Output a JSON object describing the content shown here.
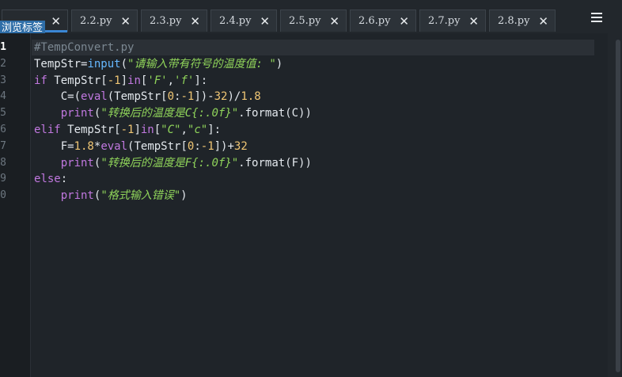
{
  "tabs": [
    {
      "label": "",
      "active": true
    },
    {
      "label": "2.2.py"
    },
    {
      "label": "2.3.py"
    },
    {
      "label": "2.4.py"
    },
    {
      "label": "2.5.py"
    },
    {
      "label": "2.6.py"
    },
    {
      "label": "2.7.py"
    },
    {
      "label": "2.8.py"
    }
  ],
  "tooltip": "浏览标签",
  "colors": {
    "accent": "#3a86d4",
    "background": "#1f2429"
  },
  "editor": {
    "line_numbers": [
      "1",
      "2",
      "3",
      "4",
      "5",
      "6",
      "7",
      "8",
      "9",
      "0"
    ],
    "current_line": 1,
    "lines": [
      [
        {
          "t": "#TempConvert.py",
          "c": "c"
        }
      ],
      [
        {
          "t": "TempStr=",
          "c": "op"
        },
        {
          "t": "input",
          "c": "fn"
        },
        {
          "t": "(",
          "c": "op"
        },
        {
          "t": "\"请输入带有符号的温度值: \"",
          "c": "str"
        },
        {
          "t": ")",
          "c": "op"
        }
      ],
      [
        {
          "t": "if",
          "c": "kw"
        },
        {
          "t": " TempStr[",
          "c": "op"
        },
        {
          "t": "-1",
          "c": "num"
        },
        {
          "t": "]",
          "c": "op"
        },
        {
          "t": "in",
          "c": "kw"
        },
        {
          "t": "[",
          "c": "op"
        },
        {
          "t": "'F'",
          "c": "str"
        },
        {
          "t": ",",
          "c": "op"
        },
        {
          "t": "'f'",
          "c": "str"
        },
        {
          "t": "]:",
          "c": "op"
        }
      ],
      [
        {
          "t": "    C=(",
          "c": "op"
        },
        {
          "t": "eval",
          "c": "kw"
        },
        {
          "t": "(TempStr[",
          "c": "op"
        },
        {
          "t": "0",
          "c": "num"
        },
        {
          "t": ":",
          "c": "op"
        },
        {
          "t": "-1",
          "c": "num"
        },
        {
          "t": "])-",
          "c": "op"
        },
        {
          "t": "32",
          "c": "num"
        },
        {
          "t": ")/",
          "c": "op"
        },
        {
          "t": "1.8",
          "c": "num"
        }
      ],
      [
        {
          "t": "    ",
          "c": "op"
        },
        {
          "t": "print",
          "c": "kw"
        },
        {
          "t": "(",
          "c": "op"
        },
        {
          "t": "\"转换后的温度是C{:.0f}\"",
          "c": "str"
        },
        {
          "t": ".format(C))",
          "c": "op"
        }
      ],
      [
        {
          "t": "elif",
          "c": "kw"
        },
        {
          "t": " TempStr[",
          "c": "op"
        },
        {
          "t": "-1",
          "c": "num"
        },
        {
          "t": "]",
          "c": "op"
        },
        {
          "t": "in",
          "c": "kw"
        },
        {
          "t": "[",
          "c": "op"
        },
        {
          "t": "\"C\"",
          "c": "str"
        },
        {
          "t": ",",
          "c": "op"
        },
        {
          "t": "\"c\"",
          "c": "str"
        },
        {
          "t": "]:",
          "c": "op"
        }
      ],
      [
        {
          "t": "    F=",
          "c": "op"
        },
        {
          "t": "1.8",
          "c": "num"
        },
        {
          "t": "*",
          "c": "op"
        },
        {
          "t": "eval",
          "c": "kw"
        },
        {
          "t": "(TempStr[",
          "c": "op"
        },
        {
          "t": "0",
          "c": "num"
        },
        {
          "t": ":",
          "c": "op"
        },
        {
          "t": "-1",
          "c": "num"
        },
        {
          "t": "])+",
          "c": "op"
        },
        {
          "t": "32",
          "c": "num"
        }
      ],
      [
        {
          "t": "    ",
          "c": "op"
        },
        {
          "t": "print",
          "c": "kw"
        },
        {
          "t": "(",
          "c": "op"
        },
        {
          "t": "\"转换后的温度是F{:.0f}\"",
          "c": "str"
        },
        {
          "t": ".format(F))",
          "c": "op"
        }
      ],
      [
        {
          "t": "else",
          "c": "kw"
        },
        {
          "t": ":",
          "c": "op"
        }
      ],
      [
        {
          "t": "    ",
          "c": "op"
        },
        {
          "t": "print",
          "c": "kw"
        },
        {
          "t": "(",
          "c": "op"
        },
        {
          "t": "\"格式输入错误\"",
          "c": "str"
        },
        {
          "t": ")",
          "c": "op"
        }
      ]
    ]
  }
}
